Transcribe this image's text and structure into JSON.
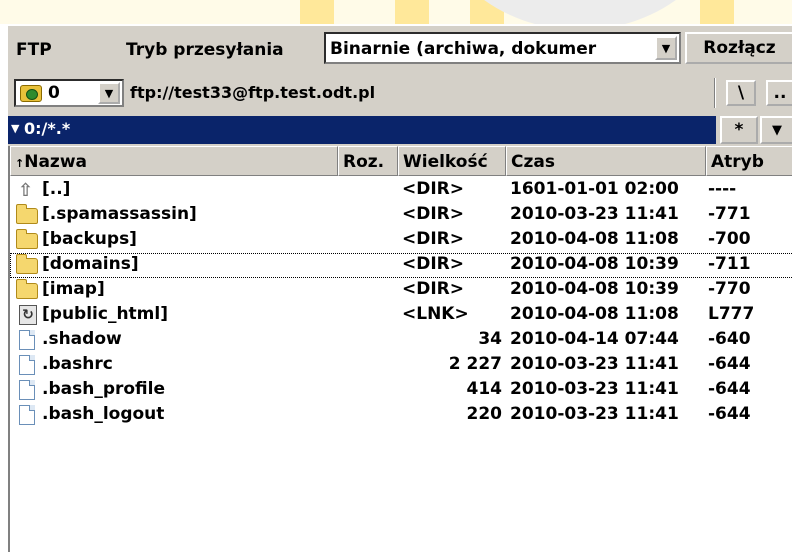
{
  "toolbar": {
    "ftp_label": "FTP",
    "mode_label": "Tryb przesyłania",
    "mode_value": "Binarnie (archiwa, dokumer",
    "disconnect_label": "Rozłącz"
  },
  "address": {
    "drive": "0",
    "url": "ftp://test33@ftp.test.odt.pl",
    "root_btn": "\\",
    "up_btn": ".."
  },
  "filter": {
    "arrow": "▼",
    "text": "0:/*.*",
    "star_btn": "*",
    "down_btn": "▼"
  },
  "columns": {
    "sort_arrow": "↑",
    "name": "Nazwa",
    "ext": "Roz.",
    "size": "Wielkość",
    "time": "Czas",
    "attr": "Atryb"
  },
  "files": [
    {
      "icon": "up-dir-icon",
      "name": "[..]",
      "size": "<DIR>",
      "time": "1601-01-01 02:00",
      "attr": "----"
    },
    {
      "icon": "folder-icon",
      "name": "[.spamassassin]",
      "size": "<DIR>",
      "time": "2010-03-23 11:41",
      "attr": "-771"
    },
    {
      "icon": "folder-icon",
      "name": "[backups]",
      "size": "<DIR>",
      "time": "2010-04-08 11:08",
      "attr": "-700"
    },
    {
      "icon": "folder-icon",
      "name": "[domains]",
      "size": "<DIR>",
      "time": "2010-04-08 10:39",
      "attr": "-711"
    },
    {
      "icon": "folder-icon",
      "name": "[imap]",
      "size": "<DIR>",
      "time": "2010-04-08 10:39",
      "attr": "-770"
    },
    {
      "icon": "link-icon",
      "name": "[public_html]",
      "size": "<LNK>",
      "time": "2010-04-08 11:08",
      "attr": "L777"
    },
    {
      "icon": "file-icon",
      "name": ".shadow",
      "size": "34",
      "time": "2010-04-14 07:44",
      "attr": "-640"
    },
    {
      "icon": "file-icon",
      "name": ".bashrc",
      "size": "2 227",
      "time": "2010-03-23 11:41",
      "attr": "-644"
    },
    {
      "icon": "file-icon",
      "name": ".bash_profile",
      "size": "414",
      "time": "2010-03-23 11:41",
      "attr": "-644"
    },
    {
      "icon": "file-icon",
      "name": ".bash_logout",
      "size": "220",
      "time": "2010-03-23 11:41",
      "attr": "-644"
    }
  ],
  "colors": {
    "panel": "#d4d0c8",
    "filter_bar": "#0a246a",
    "folder": "#f5d76e"
  }
}
